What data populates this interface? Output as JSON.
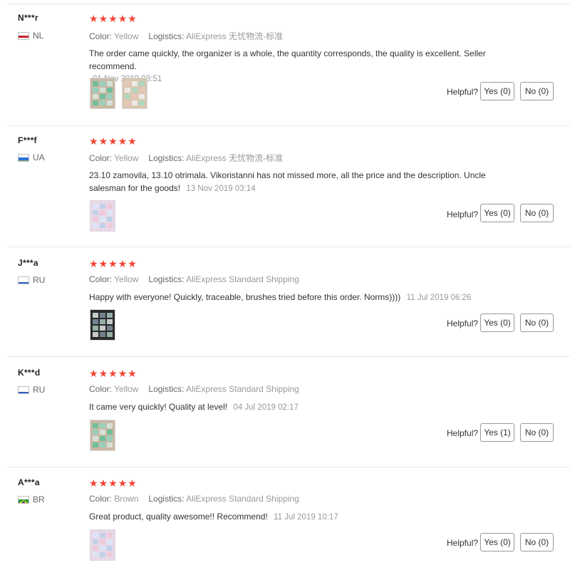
{
  "star_color": "#f44336",
  "helpful_label": "Helpful?",
  "reviews": [
    {
      "user": "N***r",
      "country": "NL",
      "flag": "netherlands-flag-icon",
      "rating": 5,
      "color_label": "Color:",
      "color_value": "Yellow",
      "logistics_label": "Logistics:",
      "logistics_value": "AliExpress 无忧物流-标准",
      "text": "The order came quickly, the organizer is a whole, the quantity corresponds, the quality is excellent. Seller recommend.",
      "date": "01 Nov 2019 03:51",
      "photo_count": 2,
      "yes": "Yes (0)",
      "no": "No (0)"
    },
    {
      "user": "F***f",
      "country": "UA",
      "flag": "ukraine-flag-icon",
      "rating": 5,
      "color_label": "Color:",
      "color_value": "Yellow",
      "logistics_label": "Logistics:",
      "logistics_value": "AliExpress 无忧物流-标准",
      "text": "23.10 zamovila, 13.10 otrimala. Vikoristanni has not missed more, all the price and the description. Uncle salesman for the goods!",
      "date": "13 Nov 2019 03:14",
      "photo_count": 1,
      "yes": "Yes (0)",
      "no": "No (0)"
    },
    {
      "user": "J***a",
      "country": "RU",
      "flag": "russia-flag-icon",
      "rating": 5,
      "color_label": "Color:",
      "color_value": "Yellow",
      "logistics_label": "Logistics:",
      "logistics_value": "AliExpress Standard Shipping",
      "text": "Happy with everyone! Quickly, traceable, brushes tried before this order. Norms))))",
      "date": "11 Jul 2019 06:26",
      "photo_count": 1,
      "yes": "Yes (0)",
      "no": "No (0)"
    },
    {
      "user": "K***d",
      "country": "RU",
      "flag": "russia-flag-icon",
      "rating": 5,
      "color_label": "Color:",
      "color_value": "Yellow",
      "logistics_label": "Logistics:",
      "logistics_value": "AliExpress Standard Shipping",
      "text": "It came very quickly! Quality at level!",
      "date": "04 Jul 2019 02:17",
      "photo_count": 1,
      "yes": "Yes (1)",
      "no": "No (0)"
    },
    {
      "user": "A***a",
      "country": "BR",
      "flag": "brazil-flag-icon",
      "rating": 5,
      "color_label": "Color:",
      "color_value": "Brown",
      "logistics_label": "Logistics:",
      "logistics_value": "AliExpress Standard Shipping",
      "text": "Great product, quality awesome!! Recommend!",
      "date": "11 Jul 2019 10:17",
      "photo_count": 1,
      "yes": "Yes (0)",
      "no": "No (0)"
    }
  ]
}
